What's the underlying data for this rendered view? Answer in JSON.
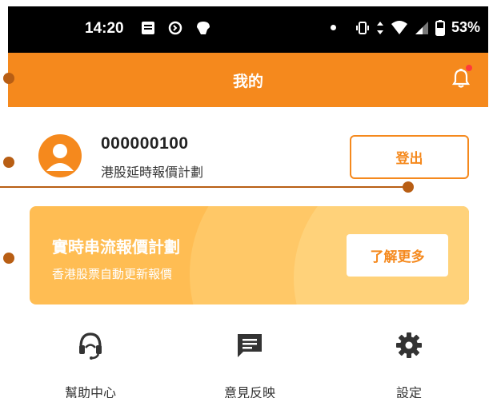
{
  "status_bar": {
    "time": "14:20",
    "battery": "53%"
  },
  "header": {
    "title": "我的",
    "has_notification": true
  },
  "profile": {
    "user_id": "000000100",
    "plan": "港股延時報價計劃",
    "logout_label": "登出"
  },
  "banner": {
    "title": "實時串流報價計劃",
    "subtitle": "香港股票自動更新報價",
    "button_label": "了解更多"
  },
  "menu": [
    {
      "label": "幫助中心",
      "icon": "headset-icon"
    },
    {
      "label": "意見反映",
      "icon": "feedback-icon"
    },
    {
      "label": "設定",
      "icon": "gear-icon"
    }
  ],
  "colors": {
    "accent": "#f5891d",
    "banner": "#ffbd53",
    "annotation": "#b85e14",
    "notification_dot": "#ff3b3b"
  }
}
